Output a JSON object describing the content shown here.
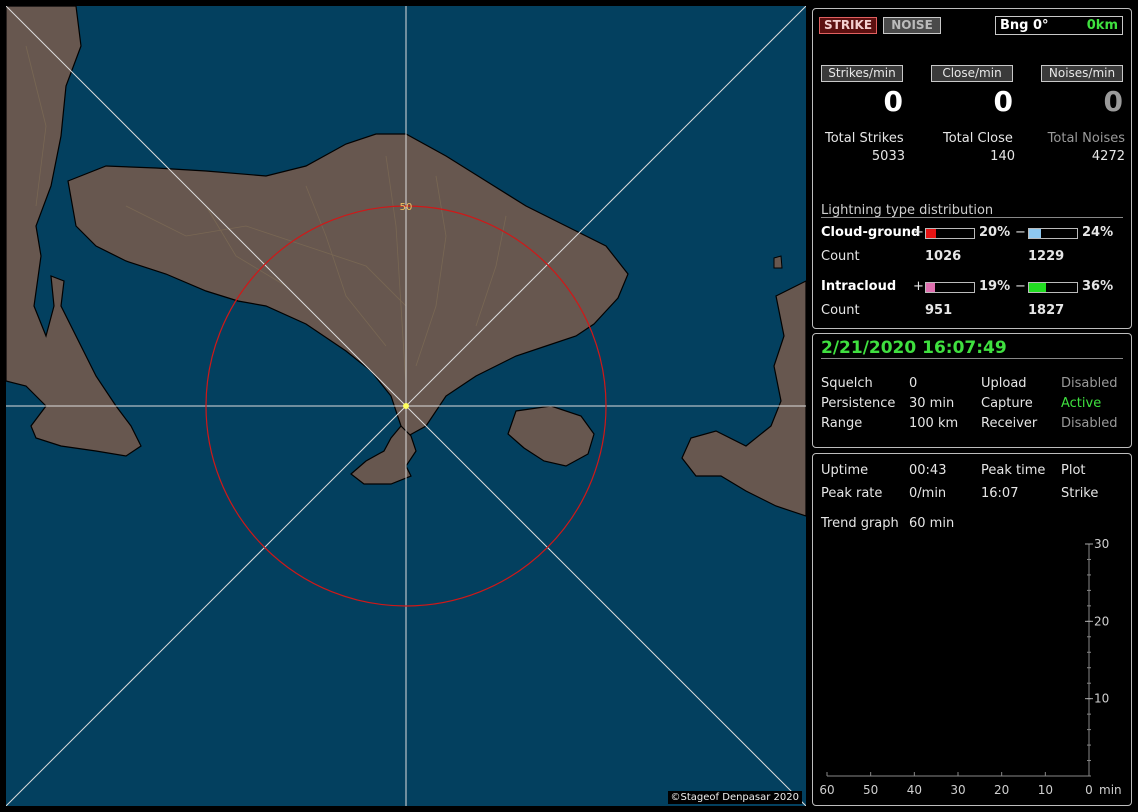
{
  "map": {
    "range_label": "50",
    "copyright": "©Stageof Denpasar 2020"
  },
  "status": {
    "strike_label": "STRIKE",
    "noise_label": "NOISE",
    "bearing_label": "Bng 0°",
    "distance_label": "0km"
  },
  "rates": {
    "strikes_label": "Strikes/min",
    "strikes_value": "0",
    "close_label": "Close/min",
    "close_value": "0",
    "noises_label": "Noises/min",
    "noises_value": "0"
  },
  "totals": {
    "strikes_label": "Total Strikes",
    "strikes_value": "5033",
    "close_label": "Total Close",
    "close_value": "140",
    "noises_label": "Total Noises",
    "noises_value": "4272"
  },
  "distribution": {
    "title": "Lightning type distribution",
    "cg_label": "Cloud-ground",
    "ic_label": "Intracloud",
    "count_label": "Count",
    "plus": "+",
    "minus": "−",
    "cg_pos_pct": "20%",
    "cg_pos_fraction": 0.2,
    "cg_pos_color": "#e51414",
    "cg_neg_pct": "24%",
    "cg_neg_fraction": 0.24,
    "cg_neg_color": "#8ec8f0",
    "ic_pos_pct": "19%",
    "ic_pos_fraction": 0.19,
    "ic_pos_color": "#e070b0",
    "ic_neg_pct": "36%",
    "ic_neg_fraction": 0.36,
    "ic_neg_color": "#22dd22",
    "cg_pos_count": "1026",
    "cg_neg_count": "1229",
    "ic_pos_count": "951",
    "ic_neg_count": "1827"
  },
  "settings": {
    "datetime": "2/21/2020 16:07:49",
    "squelch_label": "Squelch",
    "squelch_value": "0",
    "persistence_label": "Persistence",
    "persistence_value": "30 min",
    "range_label": "Range",
    "range_value": "100 km",
    "upload_label": "Upload",
    "upload_value": "Disabled",
    "capture_label": "Capture",
    "capture_value": "Active",
    "receiver_label": "Receiver",
    "receiver_value": "Disabled",
    "active_color": "#3fe03f"
  },
  "stats": {
    "uptime_label": "Uptime",
    "uptime_value": "00:43",
    "peak_time_label": "Peak time",
    "peak_time_value": "16:07",
    "plot_label": "Plot",
    "plot_value": "Strike",
    "peak_rate_label": "Peak rate",
    "peak_rate_value": "0/min",
    "trend_label": "Trend graph",
    "trend_value": "60 min"
  },
  "chart_data": {
    "type": "line",
    "title": "",
    "xlabel": "min",
    "ylabel": "",
    "x_ticks": [
      "60",
      "50",
      "40",
      "30",
      "20",
      "10",
      "0"
    ],
    "y_ticks": [
      "10",
      "20",
      "30"
    ],
    "xlim": [
      60,
      0
    ],
    "ylim": [
      0,
      30
    ],
    "series": [
      {
        "values": []
      }
    ]
  }
}
